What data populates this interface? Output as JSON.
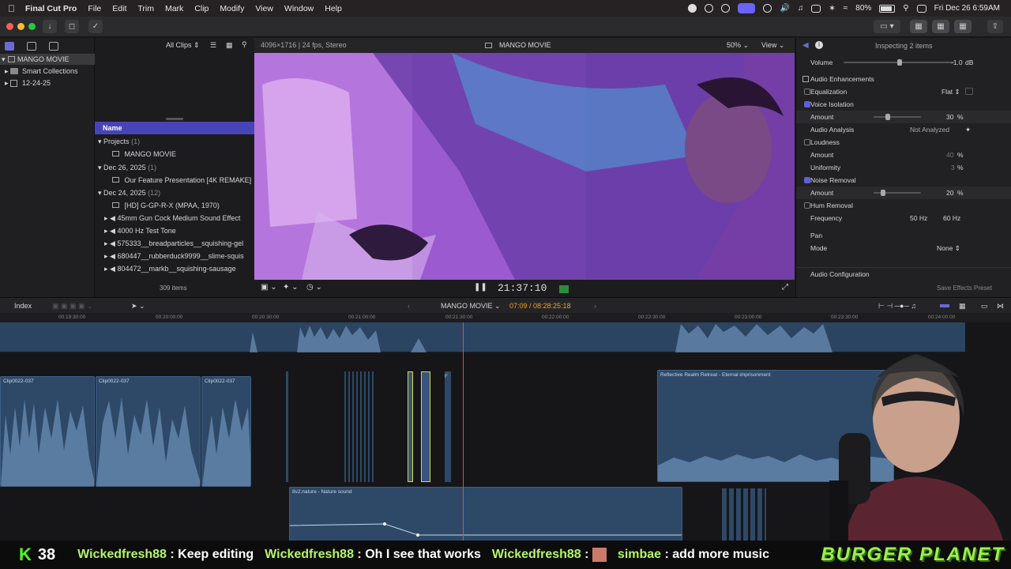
{
  "menubar": {
    "app_name": "Final Cut Pro",
    "items": [
      "File",
      "Edit",
      "Trim",
      "Mark",
      "Clip",
      "Modify",
      "View",
      "Window",
      "Help"
    ],
    "battery": "80%",
    "clock": "Fri Dec 26  6:59AM"
  },
  "library": {
    "items": [
      "MANGO MOVIE",
      "Smart Collections",
      "12-24-25"
    ]
  },
  "browser": {
    "filter": "All Clips",
    "column_header": "Name",
    "rows": [
      {
        "label": "Projects",
        "count": "(1)"
      },
      {
        "label": "MANGO MOVIE"
      },
      {
        "label": "Dec 26, 2025",
        "count": "(1)"
      },
      {
        "label": "Our Feature Presentation [4K REMAKE]"
      },
      {
        "label": "Dec 24, 2025",
        "count": "(12)"
      },
      {
        "label": "[HD] G-GP-R-X (MPAA, 1970)"
      },
      {
        "label": "45mm Gun Cock Medium Sound Effect"
      },
      {
        "label": "4000 Hz Test Tone"
      },
      {
        "label": "575333__breadparticles__squishing-gel"
      },
      {
        "label": "680447__rubberduck9999__slime-squis"
      },
      {
        "label": "804472__markb__squishing-sausage"
      }
    ],
    "item_count": "309 items"
  },
  "viewer": {
    "format": "4096×1716 | 24 fps, Stereo",
    "title": "MANGO MOVIE",
    "zoom": "50%",
    "view_label": "View",
    "timecode": "21:37:10"
  },
  "inspector": {
    "header": "Inspecting 2 items",
    "rows": [
      {
        "label": "Volume",
        "value": "-1.0",
        "unit": "dB"
      },
      {
        "label": "Audio Enhancements"
      },
      {
        "label": "Equalization",
        "value": "Flat"
      },
      {
        "label": "Voice Isolation"
      },
      {
        "label": "Amount",
        "value": "30",
        "unit": "%"
      },
      {
        "label": "Audio Analysis",
        "value": "Not Analyzed"
      },
      {
        "label": "Loudness"
      },
      {
        "label": "Amount",
        "value": "40",
        "unit": "%"
      },
      {
        "label": "Uniformity",
        "value": "3",
        "unit": "%"
      },
      {
        "label": "Noise Removal"
      },
      {
        "label": "Amount",
        "value": "20",
        "unit": "%"
      },
      {
        "label": "Hum Removal"
      },
      {
        "label": "Frequency",
        "value_a": "50 Hz",
        "value_b": "60 Hz"
      },
      {
        "label": "Pan"
      },
      {
        "label": "Mode",
        "value": "None"
      },
      {
        "label": "Audio Configuration"
      }
    ],
    "save_preset": "Save Effects Preset",
    "levels": {
      "volume": 0.75,
      "voice_isolation": 0.3,
      "noise_removal": 0.2
    }
  },
  "timeline": {
    "index_label": "Index",
    "project": "MANGO MOVIE",
    "position": "07:09 / 08:28:25:18",
    "ruler": [
      "00:19:30:00",
      "00:20:00:00",
      "00:20:30:00",
      "00:21:00:00",
      "00:21:30:00",
      "00:22:00:00",
      "00:22:30:00",
      "00:23:00:00",
      "00:23:30:00",
      "00:24:00:00"
    ],
    "clips": {
      "clip1": "Clip0022-037",
      "clip2": "Clip0022-037",
      "clip3": "Clip0022-037",
      "music": "Reflective Realm Retreat - Eternal imprisonment",
      "nature": "8v2.nature - Nature sound",
      "small": "F"
    }
  },
  "stream": {
    "count_letter": "K",
    "count": "38",
    "chat": [
      {
        "user": "Wickedfresh88",
        "sep": " : ",
        "msg": "Keep editing"
      },
      {
        "user": "Wickedfresh88",
        "sep": " : ",
        "msg": "Oh I see that works"
      },
      {
        "user": "Wickedfresh88",
        "sep": " : ",
        "msg": ""
      },
      {
        "user": "simbae",
        "sep": " : ",
        "msg": "add more music"
      }
    ],
    "brand": "BURGER PLANET"
  },
  "colors": {
    "accent": "#5f5de0",
    "clip_blue": "#2e4968",
    "playhead": "#e24a4a",
    "selected_clip": "#d8d84a",
    "chat_user": "#b6f56c"
  }
}
